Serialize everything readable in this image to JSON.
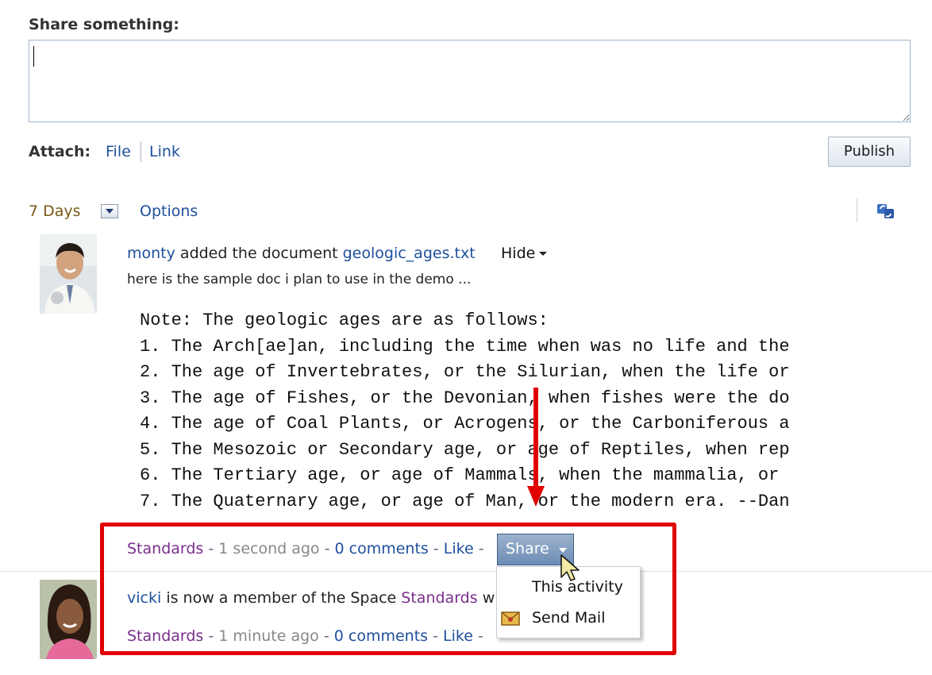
{
  "composer": {
    "label": "Share something:",
    "text_value": "",
    "attach_label": "Attach:",
    "attach_file": "File",
    "attach_link": "Link",
    "publish_label": "Publish"
  },
  "filter": {
    "period": "7 Days",
    "options_label": "Options",
    "refresh_icon": "refresh-icon"
  },
  "activities": [
    {
      "user": "monty",
      "action": "added the document",
      "document": "geologic_ages.txt",
      "hide_label": "Hide",
      "description": "here is the sample doc i plan to use in the demo ...",
      "preview_lines": [
        "Note: The geologic ages are as follows:",
        "1. The Arch[ae]an, including the time when was no life and the",
        "2. The age of Invertebrates, or the Silurian, when the life or",
        "3. The age of Fishes, or the Devonian, when fishes were the do",
        "4. The age of Coal Plants, or Acrogens, or the Carboniferous a",
        "5. The Mesozoic or Secondary age, or age of Reptiles, when rep",
        "6. The Tertiary age, or age of Mammals, when the mammalia, or",
        "7. The Quaternary age, or age of Man, or the modern era. --Dan"
      ],
      "space": "Standards",
      "time": "1 second ago",
      "comments": "0 comments",
      "like": "Like",
      "share_label": "Share"
    },
    {
      "user": "vicki",
      "action": "is now a member of the Space",
      "space_link": "Standards",
      "action_tail": "wi",
      "space": "Standards",
      "time": "1 minute ago",
      "comments": "0 comments",
      "like": "Like"
    }
  ],
  "share_menu": {
    "items": [
      {
        "label": "This activity"
      },
      {
        "label": "Send Mail",
        "icon": "mail-icon"
      }
    ]
  },
  "separator": "-",
  "colors": {
    "link": "#1f4f9c",
    "space_link": "#7a2e8c",
    "highlight": "#e00000",
    "share_button": "#7f9cc0"
  }
}
